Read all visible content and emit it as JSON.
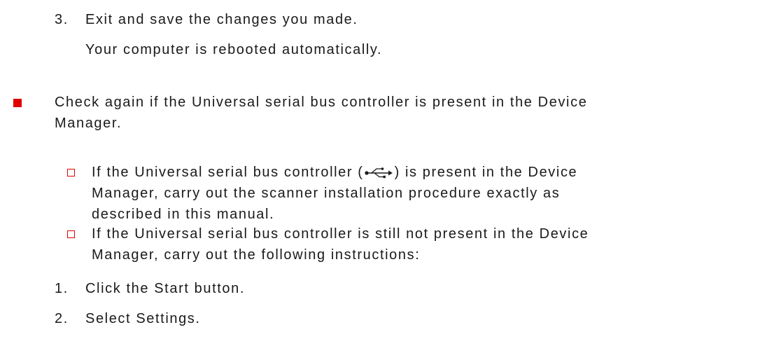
{
  "steps_top": [
    {
      "number": "3.",
      "text": "Exit and save the changes you made."
    }
  ],
  "reboot_note": "Your computer is rebooted automatically.",
  "main_bullet": {
    "line1": "Check again if the Universal serial bus controller is present in the Device",
    "line2": "Manager."
  },
  "sub_bullets": [
    {
      "line1_pre": "If the Universal serial bus controller (",
      "line1_post": ") is present in the Device",
      "icon": "usb-icon",
      "line2": "Manager, carry out the scanner installation procedure exactly as",
      "line3": "described in this manual."
    },
    {
      "line1": "If the Universal serial bus controller is still not present in the Device",
      "line2": "Manager, carry out the following instructions:"
    }
  ],
  "steps_bottom": [
    {
      "number": "1.",
      "text": "Click the Start button."
    },
    {
      "number": "2.",
      "text": "Select Settings."
    }
  ],
  "colors": {
    "bullet": "#e00000",
    "text": "#1a1a1a"
  }
}
